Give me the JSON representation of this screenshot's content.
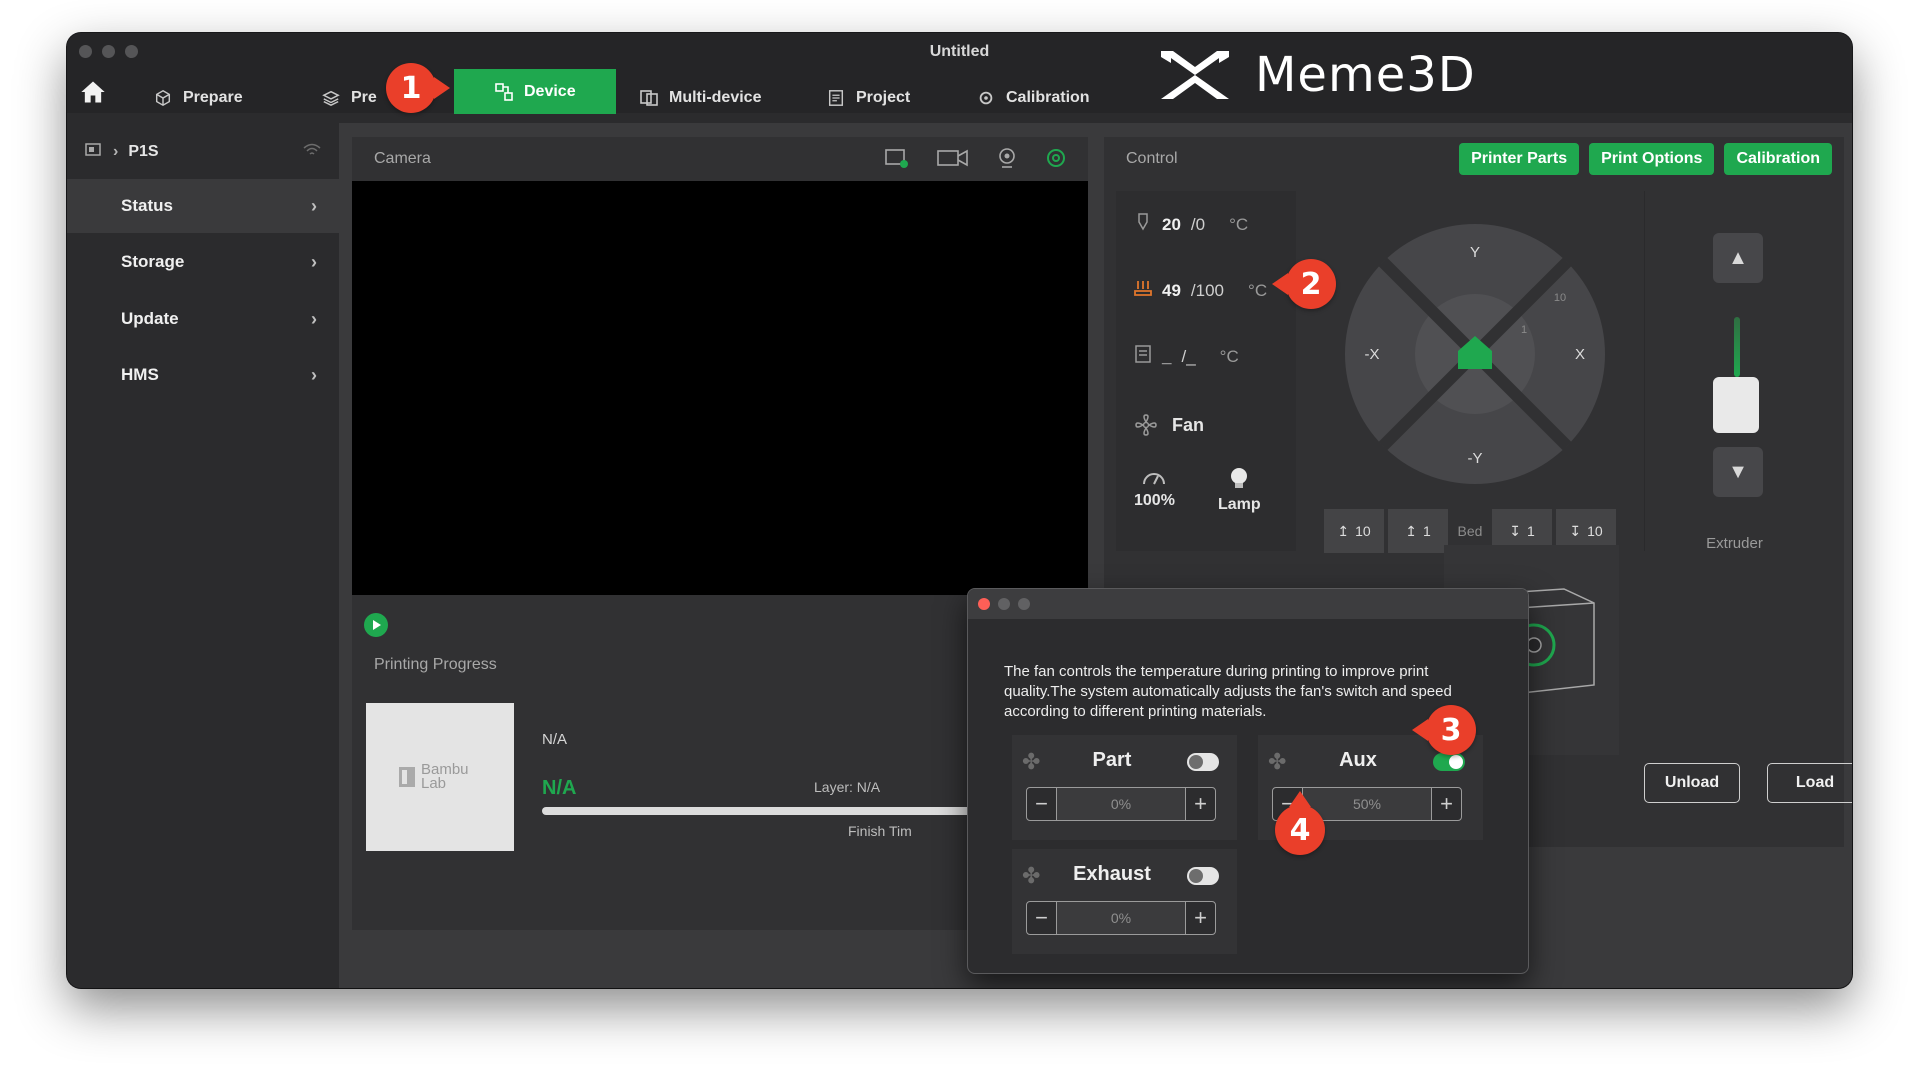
{
  "window": {
    "title": "Untitled"
  },
  "brand": {
    "name": "Meme3D"
  },
  "nav": {
    "prepare": "Prepare",
    "preview": "Pre",
    "device": "Device",
    "multi_device": "Multi-device",
    "project": "Project",
    "calibration": "Calibration"
  },
  "sidebar": {
    "device_name": "P1S",
    "items": [
      {
        "label": "Status"
      },
      {
        "label": "Storage"
      },
      {
        "label": "Update"
      },
      {
        "label": "HMS"
      }
    ]
  },
  "camera": {
    "title": "Camera"
  },
  "progress": {
    "title": "Printing Progress",
    "thumb_text": "Bambu Lab",
    "task": "N/A",
    "percent": "N/A",
    "layer": "Layer: N/A",
    "finish": "Finish Tim"
  },
  "control": {
    "title": "Control",
    "buttons": {
      "printer_parts": "Printer Parts",
      "print_options": "Print Options",
      "calibration": "Calibration"
    },
    "nozzle": {
      "current": "20",
      "target": "/0",
      "unit": "°C"
    },
    "bed": {
      "current": "49",
      "target": "/100",
      "unit": "°C"
    },
    "chamber": {
      "current": "_",
      "target": "/_",
      "unit": "°C"
    },
    "fan_label": "Fan",
    "speed": "100%",
    "lamp": "Lamp",
    "jog": {
      "y": "Y",
      "neg_y": "-Y",
      "x": "X",
      "neg_x": "-X",
      "ten": "10",
      "one": "1"
    },
    "bed_moves": {
      "up10": "10",
      "up1": "1",
      "label": "Bed",
      "down1": "1",
      "down10": "10"
    },
    "extruder_label": "Extruder",
    "unload": "Unload",
    "load": "Load"
  },
  "fan_dialog": {
    "description": "The fan controls the temperature during printing to improve print quality.The system automatically adjusts the fan's switch and speed according to different printing materials.",
    "part": {
      "label": "Part",
      "value": "0%",
      "on": false
    },
    "aux": {
      "label": "Aux",
      "value": "50%",
      "on": true
    },
    "exhaust": {
      "label": "Exhaust",
      "value": "0%",
      "on": false
    }
  },
  "callouts": {
    "c1": "1",
    "c2": "2",
    "c3": "3",
    "c4": "4"
  },
  "colors": {
    "accent": "#1fa84f",
    "callout": "#ea3f2a",
    "background": "#2b2b2d"
  }
}
